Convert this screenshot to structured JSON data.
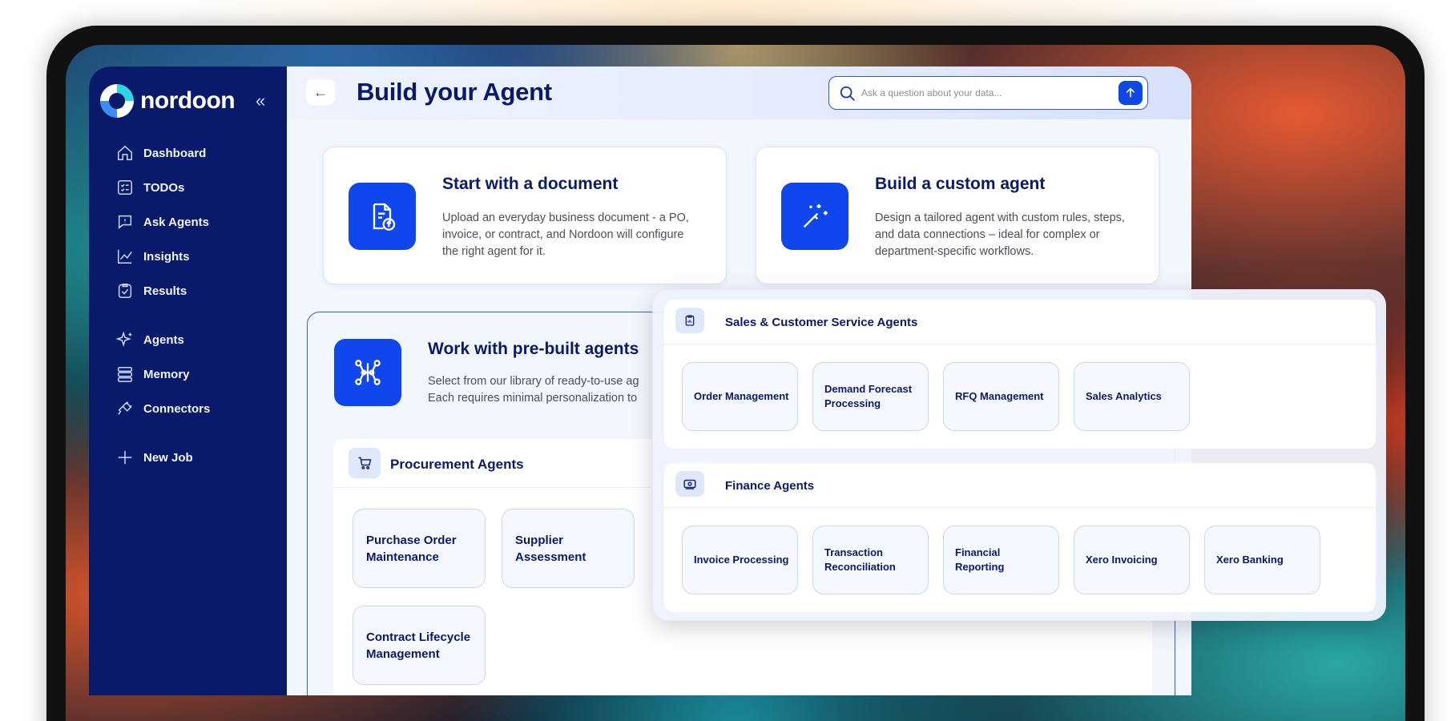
{
  "app": {
    "brand": "nordoon",
    "collapse_icon": "double-chevron-left-icon"
  },
  "sidebar": {
    "items": [
      {
        "label": "Dashboard",
        "icon": "home-icon"
      },
      {
        "label": "TODOs",
        "icon": "checklist-icon"
      },
      {
        "label": "Ask Agents",
        "icon": "chat-icon"
      },
      {
        "label": "Insights",
        "icon": "line-chart-icon"
      },
      {
        "label": "Results",
        "icon": "clipboard-check-icon"
      },
      {
        "label": "Agents",
        "icon": "sparkle-icon"
      },
      {
        "label": "Memory",
        "icon": "database-icon"
      },
      {
        "label": "Connectors",
        "icon": "plug-icon"
      },
      {
        "label": "New Job",
        "icon": "plus-icon"
      }
    ]
  },
  "header": {
    "back_label": "←",
    "title": "Build your Agent",
    "search_placeholder": "Ask a question about your data..."
  },
  "cards": {
    "document": {
      "title": "Start with a document",
      "desc": "Upload an everyday business document - a PO, invoice, or contract, and Nordoon will configure the right agent for it."
    },
    "custom": {
      "title": "Build a custom agent",
      "desc": "Design a tailored agent with custom rules, steps, and data connections – ideal for complex or department-specific workflows."
    },
    "prebuilt": {
      "title": "Work with pre-built agents",
      "desc_line1": "Select from our library of ready-to-use ag",
      "desc_line2": "Each requires minimal personalization to"
    }
  },
  "procurement": {
    "title": "Procurement Agents",
    "agents": [
      "Purchase Order Maintenance",
      "Supplier Assessment",
      "Contract Lifecycle Management"
    ]
  },
  "sales": {
    "title": "Sales &  Customer Service Agents",
    "agents": [
      "Order Management",
      "Demand Forecast Processing",
      "RFQ Management",
      "Sales Analytics"
    ]
  },
  "finance": {
    "title": "Finance Agents",
    "agents": [
      "Invoice Processing",
      "Transaction Reconciliation",
      "Financial Reporting",
      "Xero Invoicing",
      "Xero Banking"
    ]
  },
  "colors": {
    "sidebar": "#0a1a6b",
    "accent": "#0f47ec",
    "title": "#0a1a6b"
  }
}
